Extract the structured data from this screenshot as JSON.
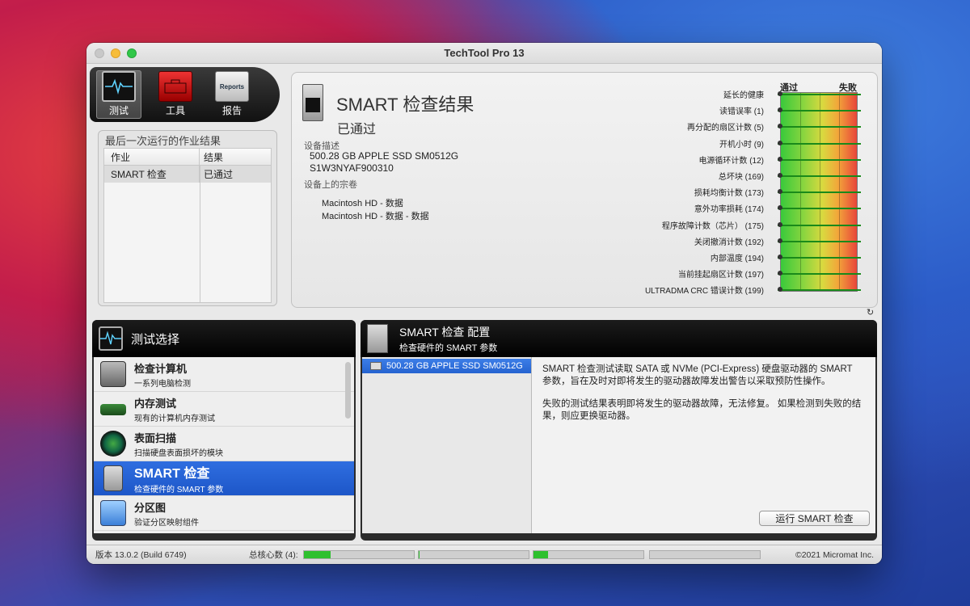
{
  "window": {
    "title": "TechTool Pro 13"
  },
  "toolbar": {
    "items": [
      {
        "label": "测试",
        "icon": "test-icon",
        "active": true
      },
      {
        "label": "工具",
        "icon": "toolbox-icon",
        "active": false
      },
      {
        "label": "报告",
        "icon": "reports-icon",
        "active": false
      }
    ],
    "report_icon_text": "Reports"
  },
  "last_run": {
    "title": "最后一次运行的作业结果",
    "columns": [
      "作业",
      "结果"
    ],
    "rows": [
      {
        "job": "SMART 检查",
        "result": "已通过"
      }
    ]
  },
  "result": {
    "title": "SMART 检查结果",
    "status": "已通过",
    "device_desc_label": "设备描述",
    "device_line1": "500.28 GB APPLE SSD SM0512G",
    "device_line2": "S1W3NYAF900310",
    "volumes_label": "设备上的宗卷",
    "volume1": "Macintosh HD - 数据",
    "volume2": "Macintosh HD - 数据 - 数据",
    "gauge_pass": "通过",
    "gauge_fail": "失败",
    "attributes": [
      "延长的健康",
      "读错误率 (1)",
      "再分配的扇区计数 (5)",
      "开机小时 (9)",
      "电源循环计数 (12)",
      "总坏块 (169)",
      "损耗均衡计数 (173)",
      "意外功率损耗 (174)",
      "程序故障计数（芯片） (175)",
      "关闭撤消计数 (192)",
      "内部温度 (194)",
      "当前挂起扇区计数 (197)",
      "ULTRADMA CRC 错误计数 (199)"
    ]
  },
  "test_selection": {
    "title": "测试选择",
    "items": [
      {
        "name": "检查计算机",
        "desc": "一系列电脑检测",
        "icon": "computer-icon",
        "selected": false
      },
      {
        "name": "内存测试",
        "desc": "现有的计算机内存测试",
        "icon": "memory-icon",
        "selected": false
      },
      {
        "name": "表面扫描",
        "desc": "扫描硬盘表面损坏的模块",
        "icon": "surface-scan-icon",
        "selected": false
      },
      {
        "name": "SMART 检查",
        "desc": "检查硬件的 SMART 参数",
        "icon": "smart-drive-icon",
        "selected": true
      },
      {
        "name": "分区图",
        "desc": "验证分区映射组件",
        "icon": "partition-icon",
        "selected": false
      }
    ]
  },
  "config": {
    "title": "SMART 检查 配置",
    "subtitle": "检查硬件的 SMART 参数",
    "drive": "500.28 GB APPLE SSD SM0512G",
    "para1": "SMART 检查测试读取 SATA 或 NVMe (PCI-Express) 硬盘驱动器的 SMART 参数，旨在及时对即将发生的驱动器故障发出警告以采取预防性操作。",
    "para2": "失败的测试结果表明即将发生的驱动器故障，无法修复。 如果检测到失败的结果，则应更换驱动器。",
    "run_button": "运行 SMART 检查"
  },
  "statusbar": {
    "version": "版本 13.0.2 (Build 6749)",
    "cores_label": "总核心数 (4):",
    "core_loads": [
      0.24,
      0.01,
      0.13,
      0.0
    ],
    "copyright": "©2021 Micromat Inc."
  },
  "colors": {
    "accent": "#2563d0",
    "pass_green": "#39c93b",
    "fail_red": "#e8453a"
  }
}
